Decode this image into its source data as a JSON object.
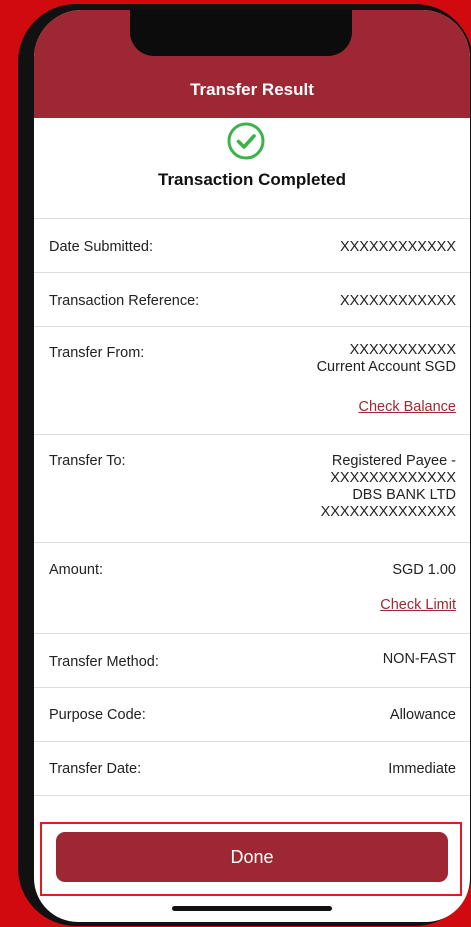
{
  "header": {
    "title": "Transfer Result"
  },
  "status": {
    "text": "Transaction Completed",
    "icon": "check-circle-icon",
    "color": "#3bb34a"
  },
  "rows": {
    "date_submitted": {
      "label": "Date Submitted:",
      "value": "XXXXXXXXXXXX"
    },
    "transaction_reference": {
      "label": "Transaction Reference:",
      "value": "XXXXXXXXXXXX"
    },
    "transfer_from": {
      "label": "Transfer From:",
      "value_line1": "XXXXXXXXXXX",
      "value_line2": "Current Account SGD",
      "link": "Check Balance"
    },
    "transfer_to": {
      "label": "Transfer To:",
      "value_line1": "Registered Payee -",
      "value_line2": "XXXXXXXXXXXXX",
      "value_line3": "DBS BANK LTD",
      "value_line4": "XXXXXXXXXXXXXX"
    },
    "amount": {
      "label": "Amount:",
      "value": "SGD 1.00",
      "link": "Check Limit"
    },
    "transfer_method": {
      "label": "Transfer Method:",
      "value": "NON-FAST"
    },
    "purpose_code": {
      "label": "Purpose Code:",
      "value": "Allowance"
    },
    "transfer_date": {
      "label": "Transfer Date:",
      "value": "Immediate"
    }
  },
  "footer": {
    "done_label": "Done"
  },
  "colors": {
    "brand": "#9d2833",
    "background": "#d10a0f",
    "highlight": "#e21b22"
  }
}
